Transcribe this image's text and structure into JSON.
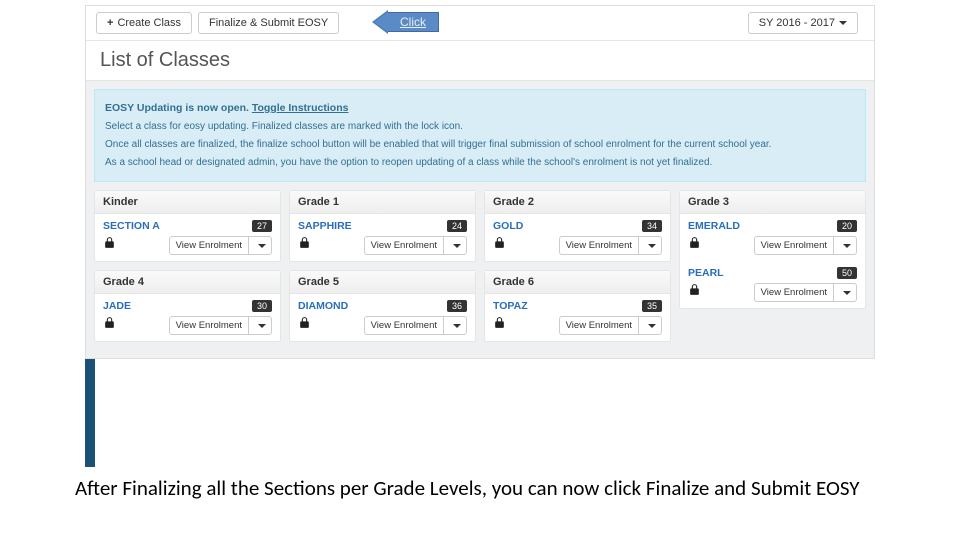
{
  "toolbar": {
    "create_label": "Create Class",
    "finalize_label": "Finalize & Submit EOSY",
    "year_label": "SY 2016 - 2017"
  },
  "page": {
    "title": "List of Classes"
  },
  "notice": {
    "head_prefix": "EOSY Updating is now open.",
    "toggle_label": "Toggle Instructions",
    "line1": "Select a class for eosy updating. Finalized classes are marked with the lock icon.",
    "line2": "Once all classes are finalized, the finalize school button will be enabled that will trigger final submission of school enrolment for the current school year.",
    "line3": "As a school head or designated admin, you have the option to reopen updating of a class while the school's enrolment is not yet finalized."
  },
  "buttons": {
    "view_enrolment": "View Enrolment"
  },
  "callout": {
    "label": "Click"
  },
  "grades": [
    {
      "name": "Kinder",
      "sections": [
        {
          "name": "SECTION A",
          "count": "27"
        }
      ]
    },
    {
      "name": "Grade 1",
      "sections": [
        {
          "name": "SAPPHIRE",
          "count": "24"
        }
      ]
    },
    {
      "name": "Grade 2",
      "sections": [
        {
          "name": "GOLD",
          "count": "34"
        }
      ]
    },
    {
      "name": "Grade 3",
      "sections": [
        {
          "name": "EMERALD",
          "count": "20"
        },
        {
          "name": "PEARL",
          "count": "50"
        }
      ]
    },
    {
      "name": "Grade 4",
      "sections": [
        {
          "name": "JADE",
          "count": "30"
        }
      ]
    },
    {
      "name": "Grade 5",
      "sections": [
        {
          "name": "DIAMOND",
          "count": "36"
        }
      ]
    },
    {
      "name": "Grade 6",
      "sections": [
        {
          "name": "TOPAZ",
          "count": "35"
        }
      ]
    }
  ],
  "caption": "After Finalizing all the Sections per Grade Levels, you can now click Finalize and Submit EOSY"
}
